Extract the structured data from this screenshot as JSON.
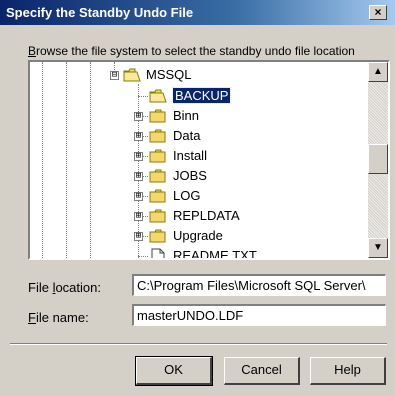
{
  "window": {
    "title": "Specify the Standby Undo File",
    "close_glyph": "×"
  },
  "browse": {
    "instruction_hotkey": "B",
    "instruction_rest": "rowse the file system to select the standby undo file location"
  },
  "tree": {
    "root": {
      "label": "MSSQL",
      "expander": "⊟",
      "icon": "open-folder-icon"
    },
    "items": [
      {
        "label": "BACKUP",
        "selected": true,
        "icon": "open-folder-icon"
      },
      {
        "label": "Binn",
        "expander": "⊞",
        "icon": "folder-icon"
      },
      {
        "label": "Data",
        "expander": "⊞",
        "icon": "folder-icon"
      },
      {
        "label": "Install",
        "expander": "⊞",
        "icon": "folder-icon"
      },
      {
        "label": "JOBS",
        "expander": "⊞",
        "icon": "folder-icon"
      },
      {
        "label": "LOG",
        "expander": "⊞",
        "icon": "folder-icon"
      },
      {
        "label": "REPLDATA",
        "expander": "⊞",
        "icon": "folder-icon"
      },
      {
        "label": "Upgrade",
        "expander": "⊞",
        "icon": "folder-icon"
      },
      {
        "label": "README.TXT",
        "icon": "file-icon"
      }
    ],
    "scroll_up_glyph": "▲",
    "scroll_down_glyph": "▼"
  },
  "file_location": {
    "label_before": "File ",
    "label_hotkey": "l",
    "label_after": "ocation:",
    "value": "C:\\Program Files\\Microsoft SQL Server\\"
  },
  "file_name": {
    "label_hotkey": "F",
    "label_after": "ile name:",
    "value": "masterUNDO.LDF"
  },
  "buttons": {
    "ok": "OK",
    "cancel": "Cancel",
    "help": "Help"
  },
  "colors": {
    "titlebar": "#0a246a",
    "selection": "#0a246a",
    "dialog_face": "#d4d0c8",
    "folder": "#f5d76e"
  }
}
